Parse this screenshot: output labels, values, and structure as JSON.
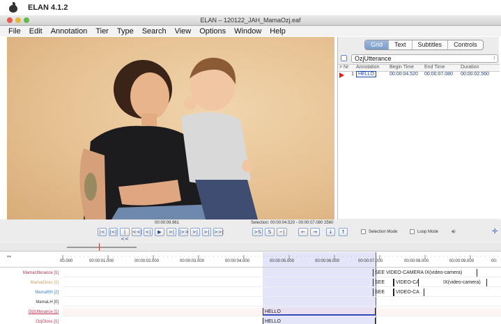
{
  "app": {
    "name": "ELAN 4.1.2",
    "window_title": "ELAN – 120122_JAH_MamaOzj.eaf"
  },
  "menu": [
    "File",
    "Edit",
    "Annotation",
    "Tier",
    "Type",
    "Search",
    "View",
    "Options",
    "Window",
    "Help"
  ],
  "right_panel": {
    "tabs": [
      "Grid",
      "Text",
      "Subtitles",
      "Controls"
    ],
    "active_tab": "Grid",
    "tier_select": "OzjUtterance",
    "grid_headers": [
      "> Nr",
      "Annotation",
      "Begin Time",
      "End Time",
      "Duration"
    ],
    "grid_rows": [
      {
        "nr": "1",
        "annotation": "HELLO",
        "begin": "00:00:04.520",
        "end": "00:00:07.080",
        "duration": "00:00:02.560"
      }
    ]
  },
  "controls": {
    "current_time": "00:00:09.961",
    "selection": "Selection: 00:00:04.520 - 00:00:07.080  2560",
    "buttons": [
      "|<",
      "|<|",
      "|<<",
      "<<|",
      "<|",
      "▶",
      ">|",
      "|>>",
      ">|",
      ">|",
      ">>|",
      ">S",
      "S",
      "−|",
      "←",
      "→",
      "↓",
      "↑"
    ],
    "selection_mode_label": "Selection Mode",
    "loop_mode_label": "Loop Mode"
  },
  "timeline": {
    "ticks": [
      "00.000",
      "00:00:01.000",
      "00:00:02.000",
      "00:00:03.000",
      "00:00:04.000",
      "00:00:05.000",
      "00:00:06.000",
      "00:00:07.000",
      "00:00:08.000",
      "00:00:09.000",
      "00:"
    ],
    "tiers": [
      {
        "label": "MamaUtterance [1]",
        "color": "#b0324a"
      },
      {
        "label": "MamaGloss [1]",
        "color": "#c8a060"
      },
      {
        "label": "MamaRH [2]",
        "color": "#3a7fc8"
      },
      {
        "label": "MamaLH [0]",
        "color": "#333333"
      },
      {
        "label": "OzjUtterance [1]",
        "color": "#c03050"
      },
      {
        "label": "OzjGloss [1]",
        "color": "#c03050"
      }
    ],
    "annotations": {
      "mama_utterance": "SEE VIDEO-CAMERA IX(video-camera)",
      "mama_gloss": [
        "SEE",
        "VIDEO-CA",
        "IX(video-camera)"
      ],
      "mama_rh": [
        "SEE",
        "VIDEO-CA"
      ],
      "ozj_utterance": "HELLO",
      "ozj_gloss": "HELLO"
    }
  },
  "colors": {
    "selection": "#b4b4f0",
    "crosshair": "#cc3333",
    "active_tab": "#7c9bc9"
  }
}
